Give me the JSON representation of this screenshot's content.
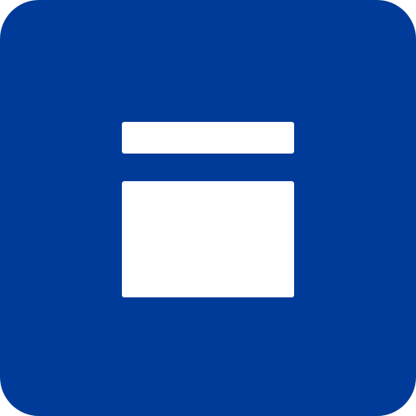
{
  "icon": {
    "name": "window-layout-icon",
    "background_color": "#003b99",
    "glyph_color": "#ffffff"
  }
}
